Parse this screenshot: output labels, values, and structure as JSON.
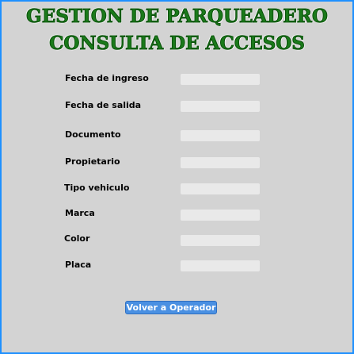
{
  "header": {
    "title_line1": "GESTION DE PARQUEADERO",
    "title_line2": "CONSULTA DE ACCESOS"
  },
  "form": {
    "fields": [
      {
        "label": "Fecha de ingreso",
        "value": ""
      },
      {
        "label": "Fecha de salida",
        "value": ""
      },
      {
        "label": "Documento",
        "value": ""
      },
      {
        "label": "Propietario",
        "value": ""
      },
      {
        "label": "Tipo vehiculo",
        "value": ""
      },
      {
        "label": "Marca",
        "value": ""
      },
      {
        "label": "Color",
        "value": ""
      },
      {
        "label": "Placa",
        "value": ""
      }
    ]
  },
  "actions": {
    "back_label": "Volver a Operador"
  },
  "colors": {
    "background": "#d3d3d3",
    "frame_border": "#1e90ff",
    "title": "#1a7a1a",
    "button": "#4a90e2"
  }
}
